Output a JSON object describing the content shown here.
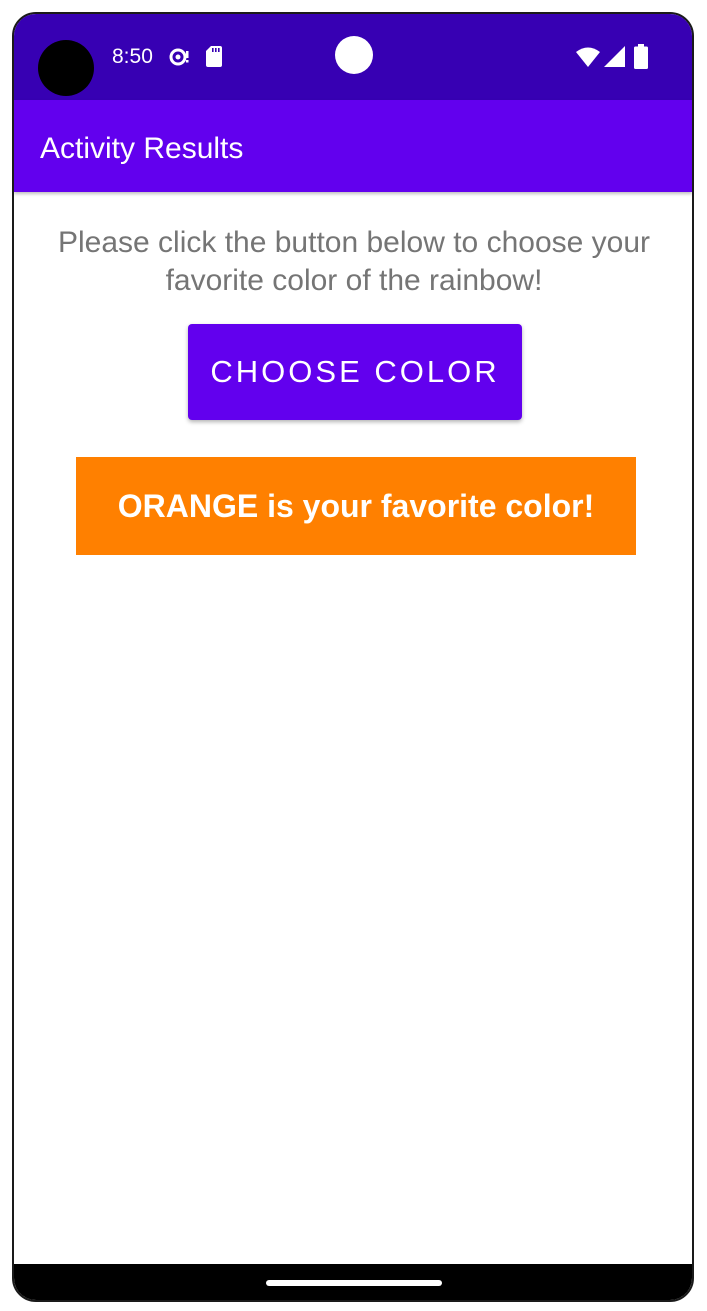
{
  "status_bar": {
    "time": "8:50",
    "icons": [
      "sync-icon",
      "sd-card-icon",
      "wifi-icon",
      "signal-icon",
      "battery-icon"
    ],
    "background": "#3700b3"
  },
  "app_bar": {
    "title": "Activity Results",
    "background": "#6200ee"
  },
  "main": {
    "instructions": "Please click the button below to choose your favorite color of the rainbow!",
    "choose_button_label": "CHOOSE COLOR",
    "result_text": "ORANGE is your favorite color!",
    "result_color": "#ff8000"
  },
  "colors": {
    "accent": "#6200ee",
    "instructions_text": "#757575"
  }
}
